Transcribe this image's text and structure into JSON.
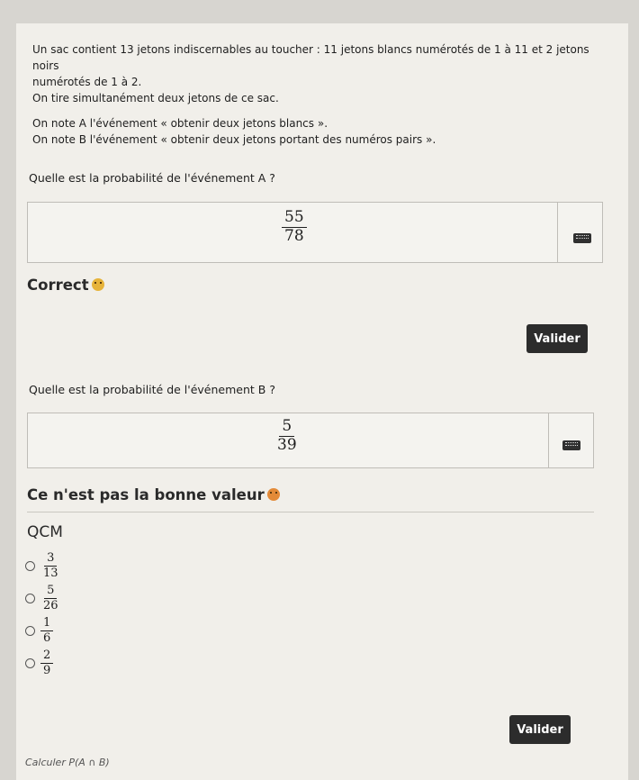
{
  "intro": {
    "line1": "Un sac contient 13 jetons indiscernables au toucher : 11 jetons blancs numérotés de 1 à 11 et 2 jetons noirs",
    "line2": "numérotés de 1 à 2.",
    "line3": "On tire simultanément deux jetons de ce sac.",
    "line4": "On note A l'événement « obtenir deux jetons blancs ».",
    "line5": "On note B l'événement « obtenir deux jetons portant des numéros pairs »."
  },
  "question_a": {
    "text": "Quelle est la probabilité de l'événement A ?",
    "answer_num": "55",
    "answer_den": "78",
    "feedback": "Correct",
    "button_label": "Valider"
  },
  "question_b": {
    "text": "Quelle est la probabilité de l'événement B ?",
    "answer_num": "5",
    "answer_den": "39",
    "feedback": "Ce n'est pas la bonne valeur"
  },
  "qcm": {
    "title": "QCM",
    "options": [
      {
        "num": "3",
        "den": "13"
      },
      {
        "num": "5",
        "den": "26"
      },
      {
        "num": "1",
        "den": "6"
      },
      {
        "num": "2",
        "den": "9"
      }
    ],
    "button_label": "Valider"
  },
  "footer": {
    "cutoff_text": "Calculer P(A ∩ B)"
  },
  "colors": {
    "button_bg": "#2c2c2c",
    "correct_emoji": "#e6b33a",
    "wrong_emoji": "#e38a38"
  },
  "icons": [
    "keyboard-icon",
    "happy-emoji-icon",
    "sad-emoji-icon",
    "radio-icon"
  ]
}
